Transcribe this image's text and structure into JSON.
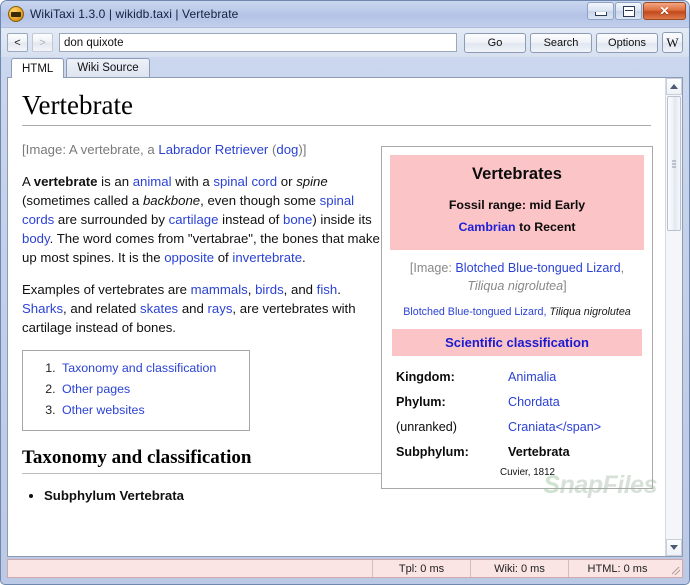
{
  "window": {
    "title": "WikiTaxi 1.3.0 | wikidb.taxi | Vertebrate",
    "icon": "wikitaxi-app-icon",
    "minimize_label": "",
    "maximize_label": "",
    "close_label": "✕"
  },
  "toolbar": {
    "back_label": "<",
    "forward_label": ">",
    "search_value": "don quixote",
    "search_placeholder": "",
    "go_label": "Go",
    "search_label": "Search",
    "options_label": "Options",
    "wikipedia_label": "W"
  },
  "tabs": [
    {
      "label": "HTML",
      "active": true
    },
    {
      "label": "Wiki Source",
      "active": false
    }
  ],
  "article": {
    "title": "Vertebrate",
    "image_note": {
      "prefix": "[Image: A vertebrate, a ",
      "link1": "Labrador Retriever",
      "mid": " (",
      "link2": "dog",
      "suffix": ")]"
    },
    "paragraph1": [
      {
        "t": "A ",
        "s": "plain"
      },
      {
        "t": "vertebrate",
        "s": "bold"
      },
      {
        "t": " is an ",
        "s": "plain"
      },
      {
        "t": "animal",
        "s": "link"
      },
      {
        "t": " with a ",
        "s": "plain"
      },
      {
        "t": "spinal cord",
        "s": "link"
      },
      {
        "t": " or ",
        "s": "plain"
      },
      {
        "t": "spine",
        "s": "ital"
      },
      {
        "t": " (sometimes called a ",
        "s": "plain"
      },
      {
        "t": "backbone",
        "s": "ital"
      },
      {
        "t": ", even though some ",
        "s": "plain"
      },
      {
        "t": "spinal cords",
        "s": "link"
      },
      {
        "t": " are surrounded by ",
        "s": "plain"
      },
      {
        "t": "cartilage",
        "s": "link"
      },
      {
        "t": " instead of ",
        "s": "plain"
      },
      {
        "t": "bone",
        "s": "link"
      },
      {
        "t": ") inside its ",
        "s": "plain"
      },
      {
        "t": "body",
        "s": "link"
      },
      {
        "t": ". The word comes from \"vertabrae\", the bones that make up most spines. It is the ",
        "s": "plain"
      },
      {
        "t": "opposite",
        "s": "link"
      },
      {
        "t": " of ",
        "s": "plain"
      },
      {
        "t": "invertebrate",
        "s": "link"
      },
      {
        "t": ".",
        "s": "plain"
      }
    ],
    "paragraph2": [
      {
        "t": "Examples of vertebrates are ",
        "s": "plain"
      },
      {
        "t": "mammals",
        "s": "link"
      },
      {
        "t": ", ",
        "s": "plain"
      },
      {
        "t": "birds",
        "s": "link"
      },
      {
        "t": ", and ",
        "s": "plain"
      },
      {
        "t": "fish",
        "s": "link"
      },
      {
        "t": ". ",
        "s": "plain"
      },
      {
        "t": "Sharks",
        "s": "link"
      },
      {
        "t": ", and related ",
        "s": "plain"
      },
      {
        "t": "skates",
        "s": "link"
      },
      {
        "t": " and ",
        "s": "plain"
      },
      {
        "t": "rays",
        "s": "link"
      },
      {
        "t": ", are vertebrates with cartilage instead of bones.",
        "s": "plain"
      }
    ],
    "toc": [
      "Taxonomy and classification",
      "Other pages",
      "Other websites"
    ],
    "section_heading": "Taxonomy and classification",
    "bullets": [
      "Subphylum Vertebrata"
    ]
  },
  "infobox": {
    "title": "Vertebrates",
    "fossil_prefix": "Fossil range: mid Early",
    "fossil_link": "Cambrian",
    "fossil_suffix": " to Recent",
    "image_note_prefix": "[Image: ",
    "image_note_link": "Blotched Blue-tongued Lizard",
    "image_note_comma": ", ",
    "image_note_species": "Tiliqua nigrolutea",
    "image_note_suffix": "]",
    "caption_link": "Blotched Blue-tongued Lizard",
    "caption_comma": ", ",
    "caption_species": "Tiliqua nigrolutea",
    "sci_header": "Scientific classification",
    "rows": [
      {
        "rank": "Kingdom:",
        "taxon": "Animalia",
        "style": "link"
      },
      {
        "rank": "Phylum:",
        "taxon": "Chordata",
        "style": "link"
      },
      {
        "rank": "(unranked)",
        "taxon": "Craniata</span>",
        "style": "link"
      },
      {
        "rank": "Subphylum:",
        "taxon": "Vertebrata",
        "style": "self"
      }
    ],
    "authority": "Cuvier, 1812"
  },
  "watermark": {
    "part1": "S",
    "part2": "napFiles"
  },
  "statusbar": {
    "left": "",
    "tpl": "Tpl: 0 ms",
    "wiki": "Wiki: 0 ms",
    "html": "HTML: 0 ms"
  },
  "colors": {
    "titlebar": "#b9c8e8",
    "infobox_pink": "#fbc4c6",
    "link_blue": "#2b42d4",
    "statusbar_pink": "#fae4e4"
  }
}
